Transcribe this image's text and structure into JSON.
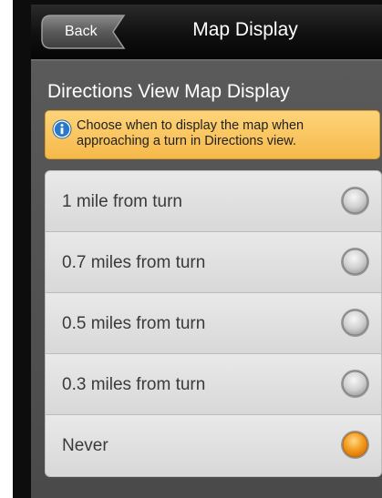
{
  "header": {
    "back_label": "Back",
    "title": "Map Display"
  },
  "section": {
    "heading": "Directions View Map Display"
  },
  "info": {
    "icon": "info-icon",
    "text": "Choose when to display the map when approaching a turn in Directions view."
  },
  "options": [
    {
      "label": "1 mile from turn",
      "selected": false
    },
    {
      "label": "0.7 miles from turn",
      "selected": false
    },
    {
      "label": "0.5 miles from turn",
      "selected": false
    },
    {
      "label": "0.3 miles from turn",
      "selected": false
    },
    {
      "label": "Never",
      "selected": true
    }
  ],
  "colors": {
    "accent_orange": "#f39a1a",
    "info_background": "#f8c45e",
    "info_icon_blue": "#2a78c8"
  }
}
